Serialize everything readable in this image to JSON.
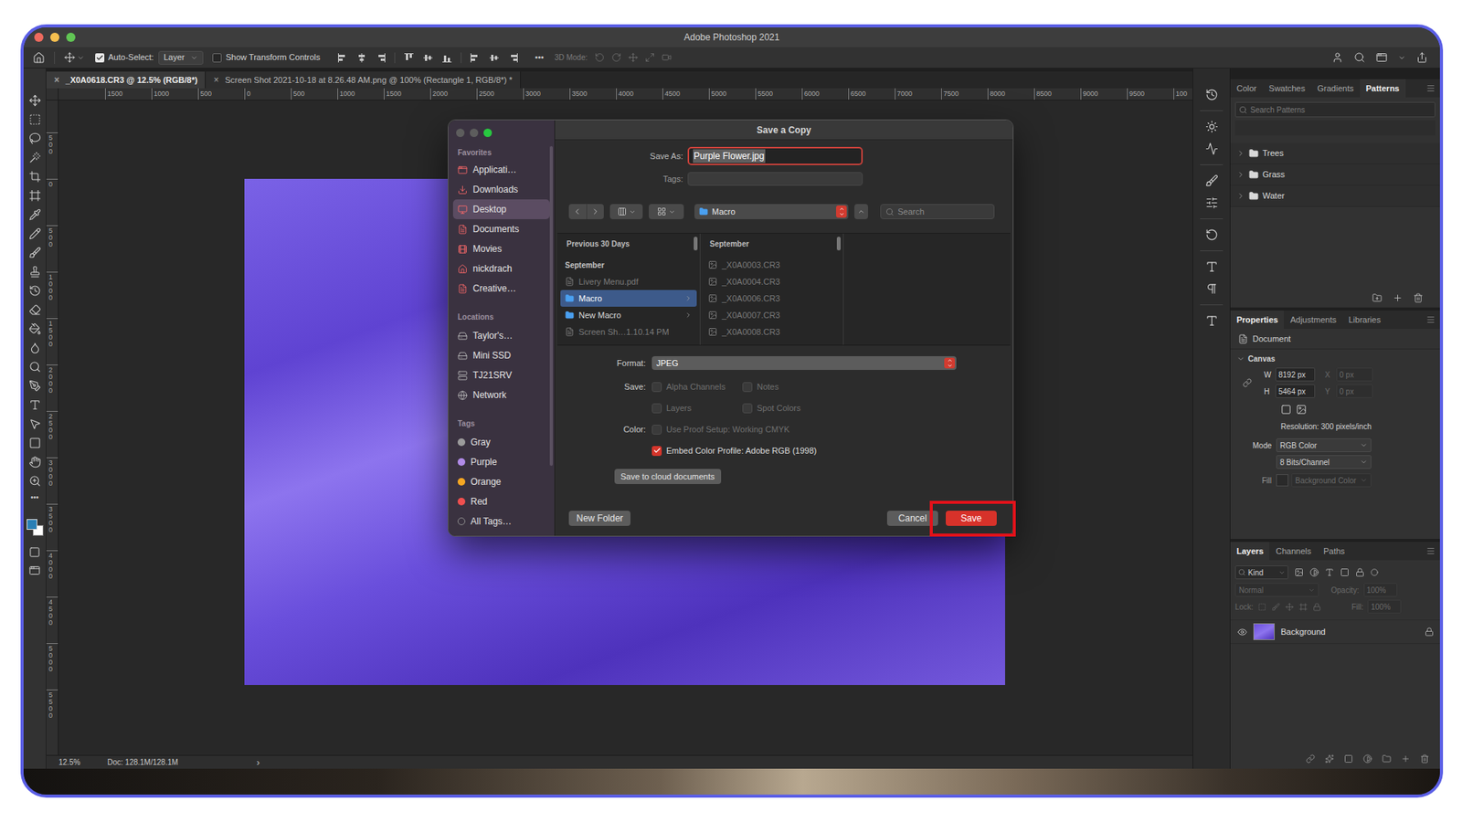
{
  "window": {
    "title": "Adobe Photoshop 2021"
  },
  "options_bar": {
    "auto_select": {
      "label": "Auto-Select:",
      "checked": true
    },
    "target": "Layer",
    "transform_controls": {
      "label": "Show Transform Controls",
      "checked": false
    },
    "more": "•••",
    "mode_3d": "3D Mode:"
  },
  "doc_tabs": [
    {
      "close": "×",
      "label": "_X0A0618.CR3 @ 12.5% (RGB/8*)",
      "selected": true
    },
    {
      "close": "×",
      "label": "Screen Shot 2021-10-18 at 8.26.48 AM.png @ 100% (Rectangle 1, RGB/8*) *",
      "selected": false
    }
  ],
  "toolbar": {
    "more": "•••"
  },
  "ruler": {
    "horizontal": [
      "1500",
      "1000",
      "500",
      "0",
      "500",
      "1000",
      "1500",
      "2000",
      "2500",
      "3000",
      "3500",
      "4000",
      "4500",
      "5000",
      "5500",
      "6000",
      "6500",
      "7000",
      "7500",
      "8000",
      "8500",
      "9000",
      "9500",
      "100"
    ],
    "vertical": [
      "500",
      "0",
      "500",
      "1000",
      "1500",
      "2000",
      "2500",
      "3000",
      "3500",
      "4000",
      "4500",
      "5000",
      "5500"
    ]
  },
  "status_bar": {
    "zoom": "12.5%",
    "doc": "Doc: 128.1M/128.1M",
    "arrow": "›"
  },
  "patterns_panel": {
    "tabs": [
      {
        "label": "Color",
        "selected": false
      },
      {
        "label": "Swatches",
        "selected": false
      },
      {
        "label": "Gradients",
        "selected": false
      },
      {
        "label": "Patterns",
        "selected": true
      }
    ],
    "search_placeholder": "Search Patterns",
    "groups": [
      {
        "name": "Trees",
        "expanded": false
      },
      {
        "name": "Grass",
        "expanded": false
      },
      {
        "name": "Water",
        "expanded": false
      }
    ]
  },
  "properties_panel": {
    "tabs": [
      {
        "label": "Properties",
        "selected": true
      },
      {
        "label": "Adjustments",
        "selected": false
      },
      {
        "label": "Libraries",
        "selected": false
      }
    ],
    "document": "Document",
    "section": {
      "label": "Canvas",
      "expanded": true
    },
    "size": [
      {
        "label": "W",
        "value": "8192 px",
        "offset_label": "X",
        "offset": "0 px",
        "offset_disabled": true
      },
      {
        "label": "H",
        "value": "5464 px",
        "offset_label": "Y",
        "offset": "0 px",
        "offset_disabled": true
      }
    ],
    "resolution": "Resolution: 300 pixels/inch",
    "mode_label": "Mode",
    "mode": "RGB Color",
    "depth": "8 Bits/Channel",
    "fill_label": "Fill",
    "fill": "Background Color",
    "fill_disabled": true
  },
  "layers_panel": {
    "tabs": [
      {
        "label": "Layers",
        "selected": true
      },
      {
        "label": "Channels",
        "selected": false
      },
      {
        "label": "Paths",
        "selected": false
      }
    ],
    "filter": "Kind",
    "blend": "Normal",
    "opacity_label": "Opacity:",
    "opacity": "100%",
    "lock_label": "Lock:",
    "fill_label": "Fill:",
    "fill": "100%",
    "controls_disabled": true,
    "layers": [
      {
        "name": "Background",
        "visible": true,
        "locked": true,
        "selected": false
      }
    ]
  },
  "dialog": {
    "title": "Save a Copy",
    "sidebar": [
      {
        "heading": "Favorites",
        "items": [
          {
            "label": "Applicati…",
            "selected": false
          },
          {
            "label": "Downloads",
            "selected": false
          },
          {
            "label": "Desktop",
            "selected": true
          },
          {
            "label": "Documents",
            "selected": false
          },
          {
            "label": "Movies",
            "selected": false
          },
          {
            "label": "nickdrach",
            "selected": false
          },
          {
            "label": "Creative…",
            "selected": false
          }
        ]
      },
      {
        "heading": "Locations",
        "items": [
          {
            "label": "Taylor's…",
            "selected": false
          },
          {
            "label": "Mini SSD",
            "selected": false
          },
          {
            "label": "TJ21SRV",
            "selected": false
          },
          {
            "label": "Network",
            "selected": false
          }
        ]
      },
      {
        "heading": "Tags",
        "items": [
          {
            "label": "Gray",
            "kind": "tag",
            "color": "#9b9b9b",
            "selected": false
          },
          {
            "label": "Purple",
            "kind": "tag",
            "color": "#b18be8",
            "selected": false
          },
          {
            "label": "Orange",
            "kind": "tag",
            "color": "#f5a623",
            "selected": false
          },
          {
            "label": "Red",
            "kind": "tag",
            "color": "#ef4f4f",
            "selected": false
          },
          {
            "label": "All Tags…",
            "kind": "all",
            "color": "#8e8e8e",
            "selected": false
          }
        ]
      }
    ],
    "save_as": {
      "label": "Save As:",
      "value": "Purple Flower.jpg"
    },
    "tags": {
      "label": "Tags:",
      "value": ""
    },
    "location": "Macro",
    "search_placeholder": "Search",
    "columns": [
      {
        "header": "Previous 30 Days",
        "items": [
          {
            "label": "September",
            "kind": "section",
            "selected": false,
            "disabled": false
          },
          {
            "label": "Livery Menu.pdf",
            "kind": "file",
            "selected": false,
            "disabled": true
          },
          {
            "label": "Macro",
            "kind": "folder",
            "selected": true,
            "disabled": false
          },
          {
            "label": "New Macro",
            "kind": "folder",
            "selected": false,
            "disabled": false
          },
          {
            "label": "Screen Sh…1.10.14 PM",
            "kind": "file",
            "selected": false,
            "disabled": true
          }
        ]
      },
      {
        "header": "September",
        "items": [
          {
            "label": "_X0A0003.CR3",
            "kind": "image",
            "selected": false,
            "disabled": true
          },
          {
            "label": "_X0A0004.CR3",
            "kind": "image",
            "selected": false,
            "disabled": true
          },
          {
            "label": "_X0A0006.CR3",
            "kind": "image",
            "selected": false,
            "disabled": true
          },
          {
            "label": "_X0A0007.CR3",
            "kind": "image",
            "selected": false,
            "disabled": true
          },
          {
            "label": "_X0A0008.CR3",
            "kind": "image",
            "selected": false,
            "disabled": true
          }
        ]
      }
    ],
    "format": {
      "label": "Format:",
      "value": "JPEG"
    },
    "save_options": {
      "label": "Save:",
      "items": [
        {
          "label": "Alpha Channels",
          "checked": false,
          "disabled": true
        },
        {
          "label": "Notes",
          "checked": false,
          "disabled": true
        },
        {
          "label": "Layers",
          "checked": false,
          "disabled": true
        },
        {
          "label": "Spot Colors",
          "checked": false,
          "disabled": true
        }
      ]
    },
    "color_options": {
      "label": "Color:",
      "items": [
        {
          "label": "Use Proof Setup: Working CMYK",
          "checked": false,
          "disabled": true
        },
        {
          "label": "Embed Color Profile: Adobe RGB (1998)",
          "checked": true,
          "disabled": false
        }
      ]
    },
    "cloud_button": "Save to cloud documents",
    "buttons": [
      {
        "label": "New Folder",
        "kind": "secondary",
        "highlighted": false
      },
      {
        "label": "Cancel",
        "kind": "secondary",
        "highlighted": false
      },
      {
        "label": "Save",
        "kind": "primary",
        "highlighted": true
      }
    ]
  }
}
